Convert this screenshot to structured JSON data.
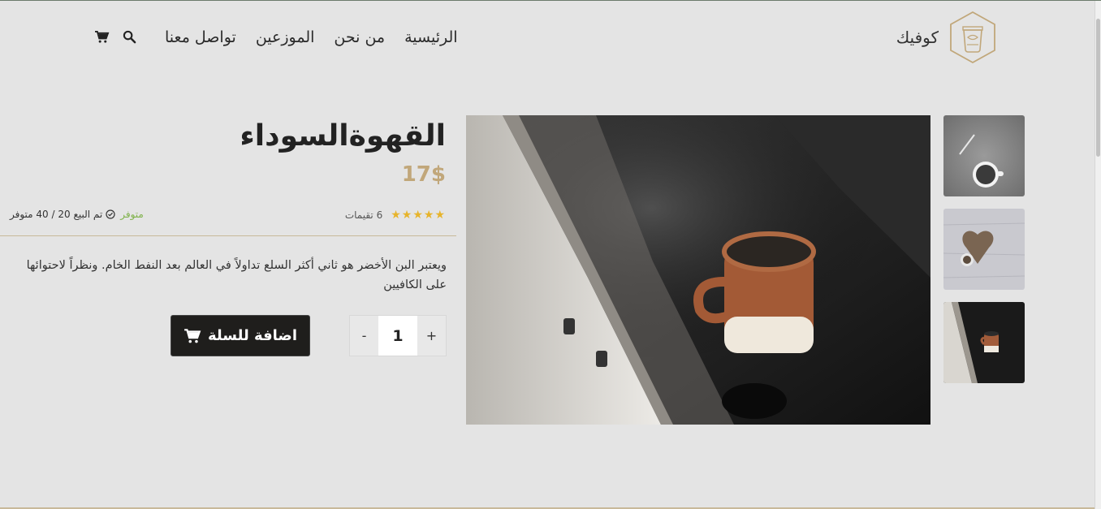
{
  "header": {
    "logo_text": "كوفيك",
    "nav": [
      "الرئيسية",
      "من نحن",
      "الموزعين",
      "تواصل معنا"
    ],
    "icons": [
      "search-icon",
      "cart-icon"
    ]
  },
  "product": {
    "title": "القهوةالسوداء",
    "price": "17$",
    "rating_stars": 5,
    "ratings_count": "6 تقيمات",
    "stock_available": "متوفر",
    "sold_text": "تم البيع 20 / 40 متوفر",
    "description": "ويعتبر البن الأخضر هو ثاني أكثر السلع تداولاً في العالم بعد النفط الخام. ونظراً لاحتوائها على الكافيين",
    "quantity": "1",
    "qty_plus": "+",
    "qty_minus": "-",
    "add_to_cart": "اضافة للسلة"
  },
  "colors": {
    "accent": "#c1a77a",
    "stars": "#e7b42b",
    "available": "#7fb24a",
    "button": "#1f1e1c"
  }
}
